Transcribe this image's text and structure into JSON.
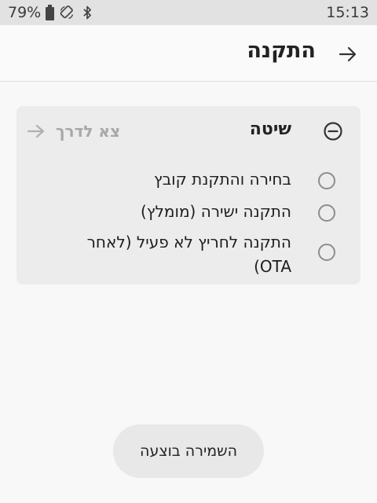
{
  "status_bar": {
    "battery_percent": "79%",
    "time": "15:13",
    "icons": [
      "battery-icon",
      "rotate-icon",
      "bluetooth-icon"
    ]
  },
  "app_bar": {
    "title": "התקנה",
    "back_icon": "arrow-right-icon"
  },
  "method_section": {
    "title": "שיטה",
    "collapse_icon": "minus-circle-icon",
    "skip_label": "צא לדרך",
    "skip_icon": "arrow-right-icon",
    "options": [
      {
        "label": "בחירה והתקנת קובץ",
        "selected": false
      },
      {
        "label": "התקנה ישירה (מומלץ)",
        "selected": false
      },
      {
        "label": "התקנה לחריץ לא פעיל (לאחר OTA)",
        "selected": false
      }
    ]
  },
  "toast": {
    "text": "השמירה בוצעה"
  },
  "colors": {
    "background": "#f8f8f8",
    "status_bar": "#e2e2e2",
    "card": "#ececec",
    "disabled_text": "#a8a8a8",
    "toast": "#e8e8e8"
  }
}
